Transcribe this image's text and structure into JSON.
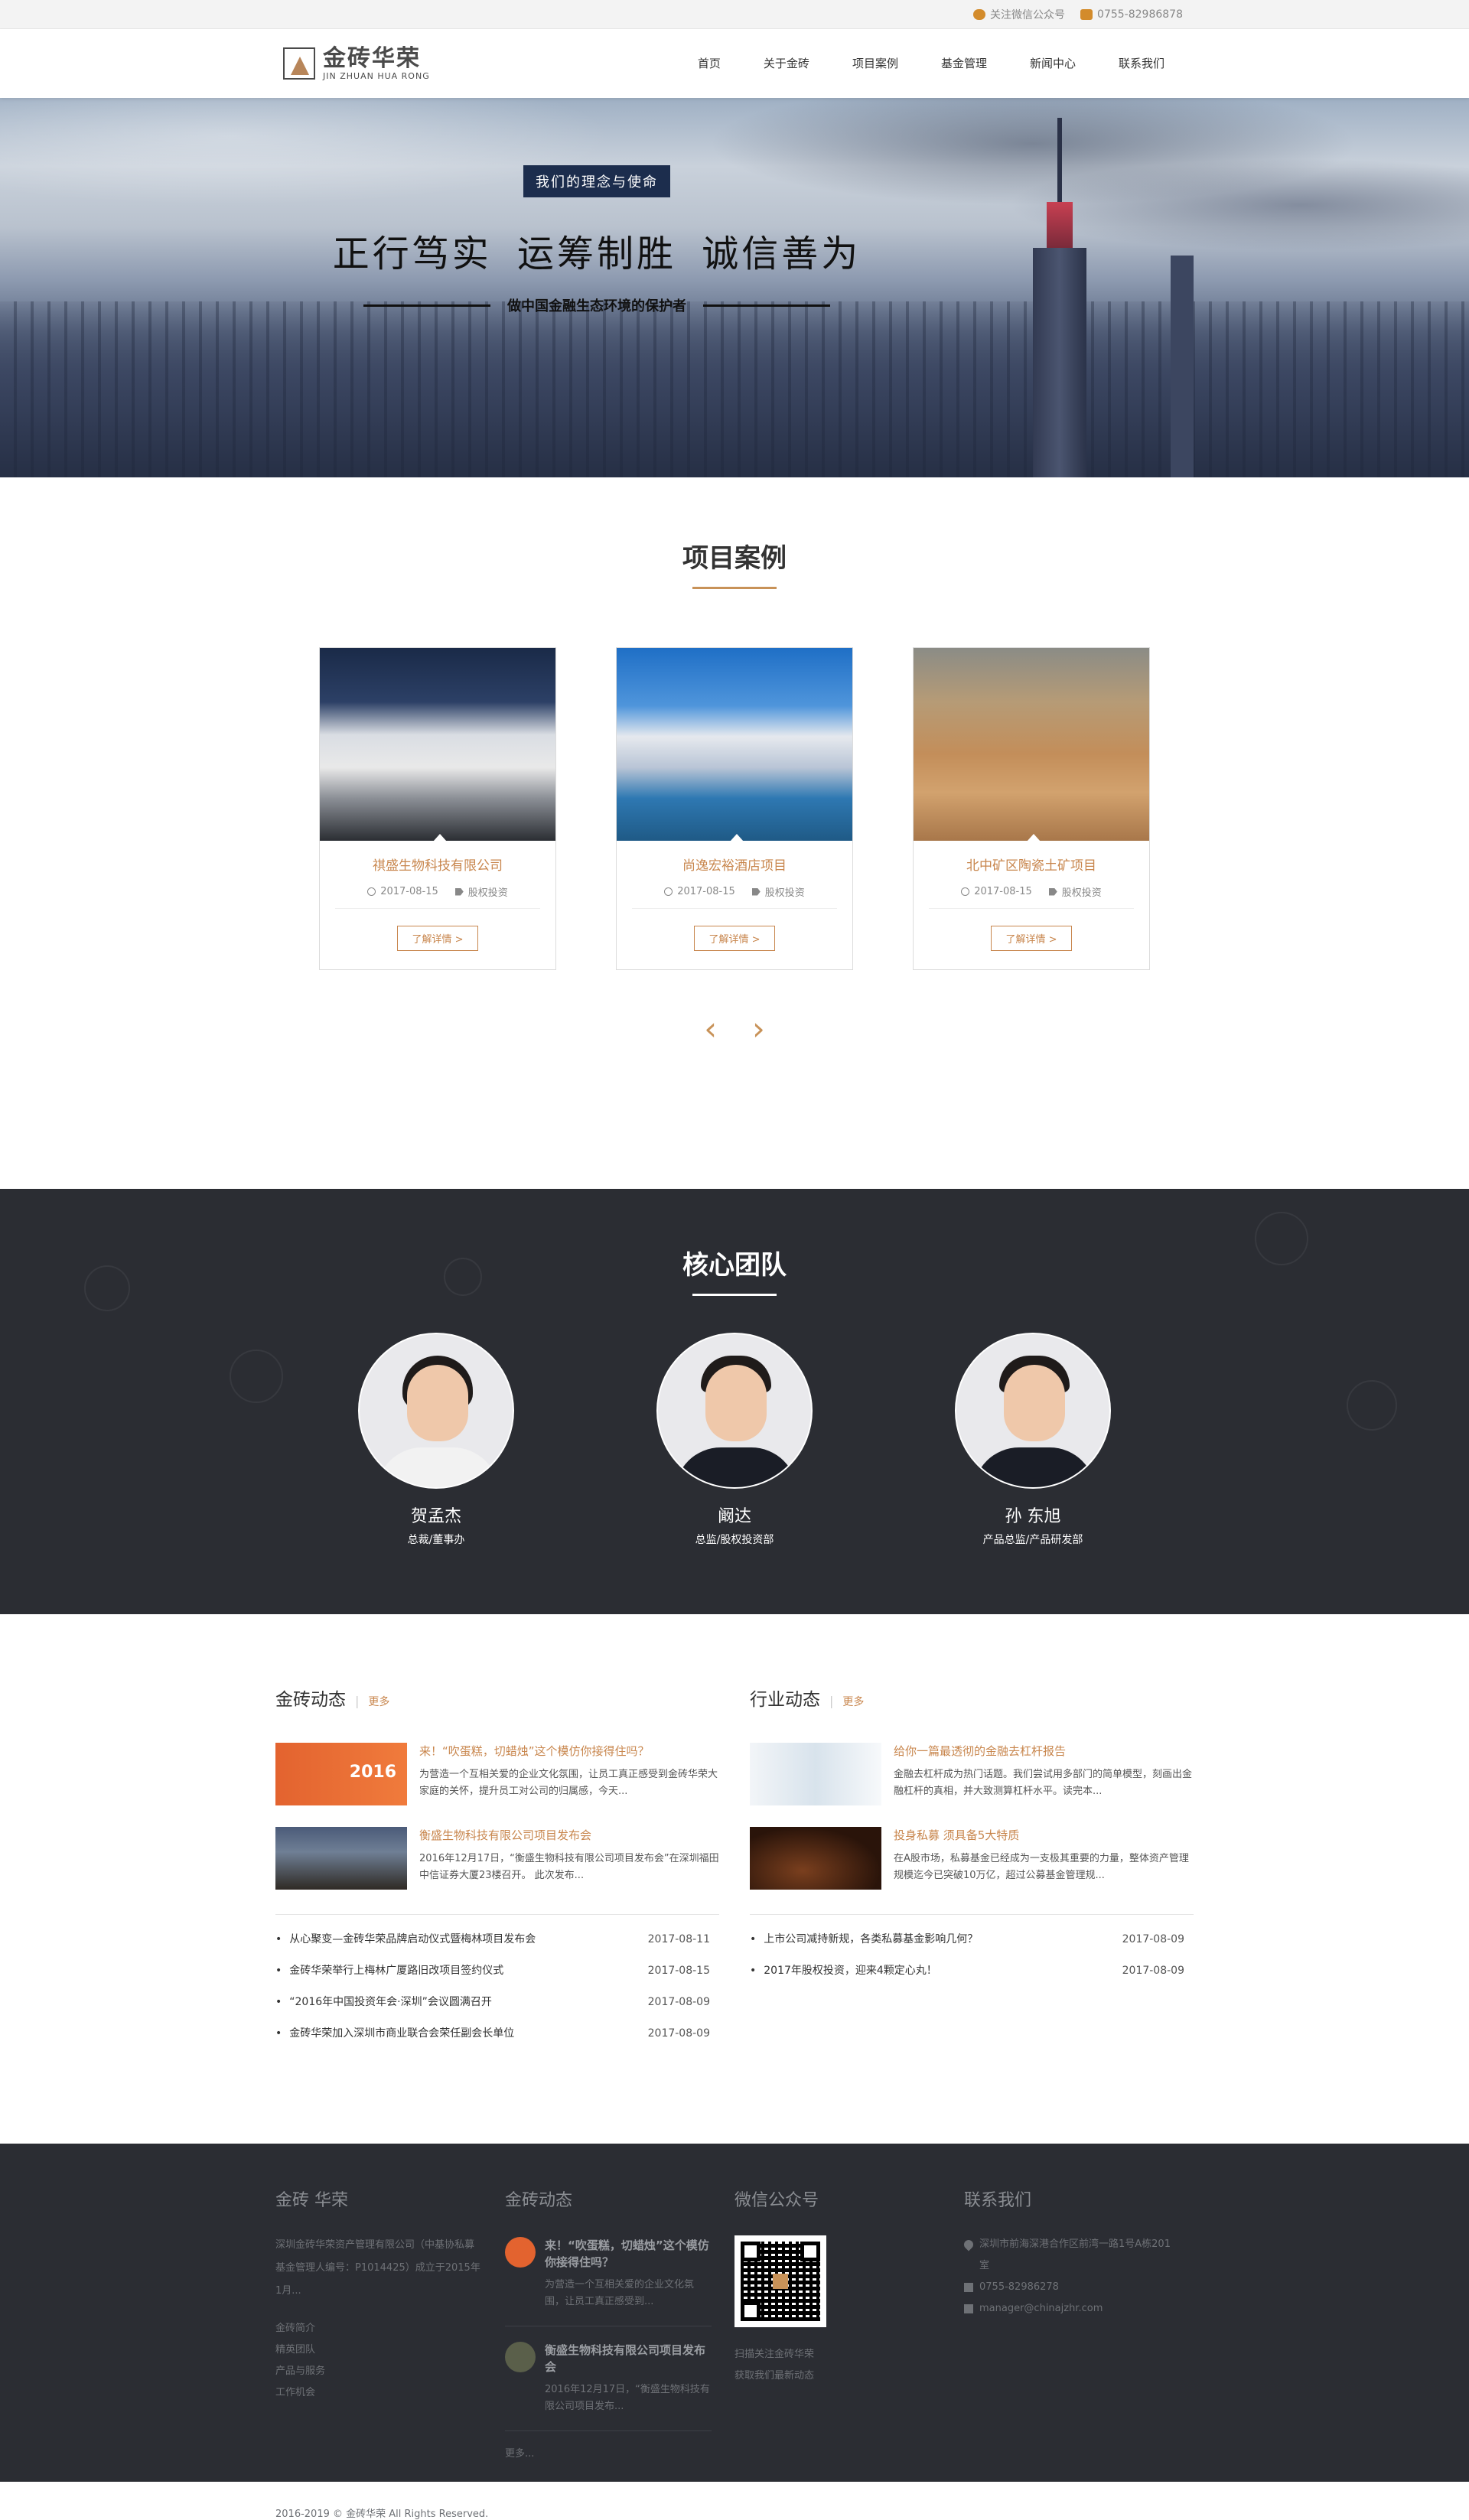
{
  "topbar": {
    "wechat": "关注微信公众号",
    "phone": "0755-82986878"
  },
  "header": {
    "logo_cn": "金砖华荣",
    "logo_en": "JIN ZHUAN HUA RONG",
    "nav": [
      "首页",
      "关于金砖",
      "项目案例",
      "基金管理",
      "新闻中心",
      "联系我们"
    ]
  },
  "banner": {
    "tag": "我们的理念与使命",
    "title": "正行笃实  运筹制胜  诚信善为",
    "subtitle": "做中国金融生态环境的保护者"
  },
  "projects": {
    "title": "项目案例",
    "items": [
      {
        "name": "祺盛生物科技有限公司",
        "date": "2017-08-15",
        "category": "股权投资",
        "button": "了解详情 >"
      },
      {
        "name": "尚逸宏裕酒店项目",
        "date": "2017-08-15",
        "category": "股权投资",
        "button": "了解详情 >"
      },
      {
        "name": "北中矿区陶瓷土矿项目",
        "date": "2017-08-15",
        "category": "股权投资",
        "button": "了解详情 >"
      }
    ],
    "prev": "‹",
    "next": "›"
  },
  "team": {
    "title": "核心团队",
    "members": [
      {
        "name": "贺孟杰",
        "role": "总裁/董事办"
      },
      {
        "name": "阚达",
        "role": "总监/股权投资部"
      },
      {
        "name": "孙 东旭",
        "role": "产品总监/产品研发部"
      }
    ]
  },
  "news": {
    "company": {
      "title": "金砖动态",
      "more": "更多",
      "features": [
        {
          "title": "来！“吹蛋糕，切蜡烛”这个模仿你接得住吗？",
          "desc": "为营造一个互相关爱的企业文化氛围，让员工真正感受到金砖华荣大家庭的关怀，提升员工对公司的归属感，今天...",
          "img_text": "2016"
        },
        {
          "title": "衡盛生物科技有限公司项目发布会",
          "desc": "2016年12月17日，“衡盛生物科技有限公司项目发布会”在深圳福田中信证券大厦23楼召开。 此次发布..."
        }
      ],
      "list": [
        {
          "title": "从心聚变—金砖华荣品牌启动仪式暨梅林项目发布会",
          "date": "2017-08-11"
        },
        {
          "title": "金砖华荣举行上梅林广厦路旧改项目签约仪式",
          "date": "2017-08-15"
        },
        {
          "title": "“2016年中国投资年会·深圳”会议圆满召开",
          "date": "2017-08-09"
        },
        {
          "title": "金砖华荣加入深圳市商业联合会荣任副会长单位",
          "date": "2017-08-09"
        }
      ]
    },
    "industry": {
      "title": "行业动态",
      "more": "更多",
      "features": [
        {
          "title": "给你一篇最透彻的金融去杠杆报告",
          "desc": "金融去杠杆成为热门话题。我们尝试用多部门的简单模型，刻画出金融杠杆的真相，并大致测算杠杆水平。读完本..."
        },
        {
          "title": "投身私募 须具备5大特质",
          "desc": "在A股市场，私募基金已经成为一支极其重要的力量，整体资产管理规模迄今已突破10万亿，超过公募基金管理规..."
        }
      ],
      "list": [
        {
          "title": "上市公司减持新规，各类私募基金影响几何？",
          "date": "2017-08-09"
        },
        {
          "title": "2017年股权投资，迎来4颗定心丸！",
          "date": "2017-08-09"
        }
      ]
    }
  },
  "footer": {
    "about": {
      "title": "金砖 华荣",
      "desc": "深圳金砖华荣资产管理有限公司（中基协私募基金管理人编号：P1014425）成立于2015年1月...",
      "links": [
        "金砖简介",
        "精英团队",
        "产品与服务",
        "工作机会"
      ]
    },
    "news": {
      "title": "金砖动态",
      "items": [
        {
          "title": "来！“吹蛋糕，切蜡烛”这个模仿你接得住吗？",
          "desc": "为营造一个互相关爱的企业文化氛围，让员工真正感受到..."
        },
        {
          "title": "衡盛生物科技有限公司项目发布会",
          "desc": "2016年12月17日，“衡盛生物科技有限公司项目发布..."
        }
      ],
      "more": "更多..."
    },
    "wechat": {
      "title": "微信公众号",
      "caption1": "扫描关注金砖华荣",
      "caption2": "获取我们最新动态"
    },
    "contact": {
      "title": "联系我们",
      "address": "深圳市前海深港合作区前湾一路1号A栋201室",
      "phone": "0755-82986278",
      "email": "manager@chinajzhr.com"
    },
    "copyright": "2016-2019 © 金砖华荣 All Rights Reserved."
  }
}
